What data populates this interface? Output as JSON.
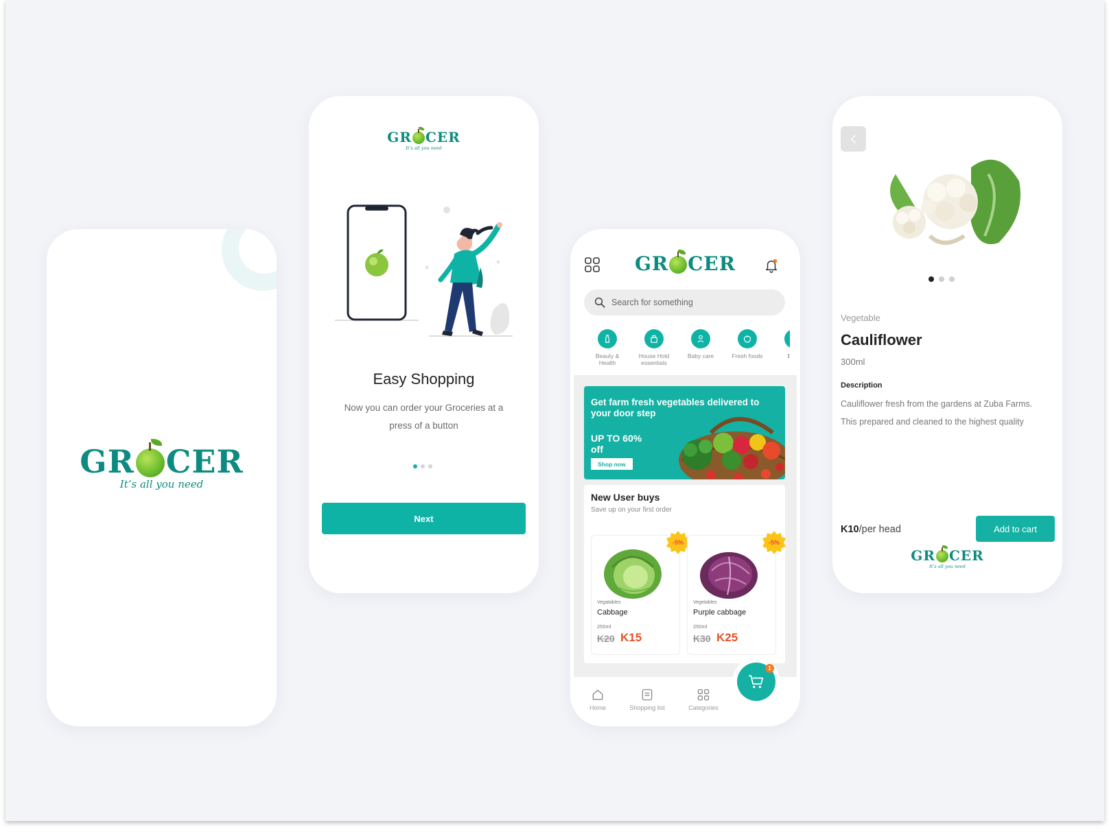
{
  "brand": {
    "name_left": "GR",
    "name_right": "CER",
    "tagline": "It’s all you need",
    "accent": "#0eb3a6",
    "logo_color": "#0e8b80"
  },
  "onboarding": {
    "title": "Easy Shopping",
    "description": "Now you can order your Groceries at a press of a button",
    "next_label": "Next",
    "page_index": 1,
    "page_count": 3
  },
  "home": {
    "menu_icon": "grid-icon",
    "notification_icon": "bell-icon",
    "search_placeholder": "Search for something",
    "categories": [
      {
        "label": "Beauty & Health",
        "icon": "bottle-icon"
      },
      {
        "label": "House Hold essentials",
        "icon": "household-icon"
      },
      {
        "label": "Baby care",
        "icon": "baby-icon"
      },
      {
        "label": "Fresh foods",
        "icon": "apple-icon"
      },
      {
        "label": "Baby",
        "icon": "baby-icon"
      }
    ],
    "banner": {
      "headline": "Get farm fresh vegetables delivered to your door step",
      "offer": "UP TO 60% off",
      "cta": "Shop now"
    },
    "new_user": {
      "title": "New User buys",
      "subtitle": "Save up on your first order",
      "products": [
        {
          "category": "Vegatables",
          "name": "Cabbage",
          "volume": "250ml",
          "old_price": "K20",
          "price": "K15",
          "discount": "-5%"
        },
        {
          "category": "Vegetables",
          "name": "Purple cabbage",
          "volume": "250ml",
          "old_price": "K30",
          "price": "K25",
          "discount": "-5%"
        }
      ]
    },
    "tabs": [
      {
        "label": "Home",
        "icon": "home-icon"
      },
      {
        "label": "Shopping list",
        "icon": "list-icon"
      },
      {
        "label": "Categories",
        "icon": "grid-icon"
      }
    ],
    "cart_count": "1"
  },
  "detail": {
    "category": "Vegetable",
    "name": "Cauliflower",
    "volume": "300ml",
    "description_heading": "Description",
    "description": "Cauliflower fresh from the gardens at Zuba Farms. This prepared and cleaned to the highest quality",
    "price": "K10",
    "unit": "/per head",
    "add_to_cart": "Add to cart",
    "image_index": 0,
    "image_count": 3
  }
}
